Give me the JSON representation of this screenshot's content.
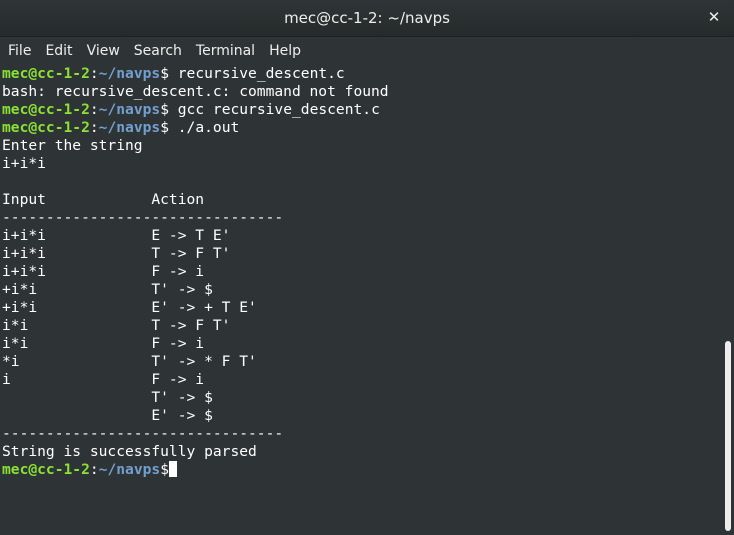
{
  "window": {
    "title": "mec@cc-1-2: ~/navps",
    "close_glyph": "✕"
  },
  "menu": [
    "File",
    "Edit",
    "View",
    "Search",
    "Terminal",
    "Help"
  ],
  "prompt": {
    "user": "mec@cc-1-2",
    "sep": ":",
    "path": "~/navps",
    "symbol": "$"
  },
  "terminal": {
    "lines": [
      {
        "type": "prompt",
        "cmd": " recursive_descent.c"
      },
      {
        "type": "text",
        "text": "bash: recursive_descent.c: command not found"
      },
      {
        "type": "prompt",
        "cmd": " gcc recursive_descent.c"
      },
      {
        "type": "prompt",
        "cmd": " ./a.out"
      },
      {
        "type": "text",
        "text": "Enter the string"
      },
      {
        "type": "text",
        "text": "i+i*i"
      },
      {
        "type": "text",
        "text": ""
      },
      {
        "type": "text",
        "text": "Input            Action"
      },
      {
        "type": "text",
        "text": "--------------------------------"
      },
      {
        "type": "text",
        "text": "i+i*i            E -> T E'"
      },
      {
        "type": "text",
        "text": "i+i*i            T -> F T'"
      },
      {
        "type": "text",
        "text": "i+i*i            F -> i"
      },
      {
        "type": "text",
        "text": "+i*i             T' -> $"
      },
      {
        "type": "text",
        "text": "+i*i             E' -> + T E'"
      },
      {
        "type": "text",
        "text": "i*i              T -> F T'"
      },
      {
        "type": "text",
        "text": "i*i              F -> i"
      },
      {
        "type": "text",
        "text": "*i               T' -> * F T'"
      },
      {
        "type": "text",
        "text": "i                F -> i"
      },
      {
        "type": "text",
        "text": "                 T' -> $"
      },
      {
        "type": "text",
        "text": "                 E' -> $"
      },
      {
        "type": "text",
        "text": "--------------------------------"
      },
      {
        "type": "text",
        "text": "String is successfully parsed"
      },
      {
        "type": "prompt",
        "cmd": "",
        "cursor": true
      }
    ]
  },
  "colors": {
    "background": "#2e3436",
    "prompt_user": "#8ae234",
    "prompt_path": "#729fcf",
    "text": "#ffffff"
  }
}
